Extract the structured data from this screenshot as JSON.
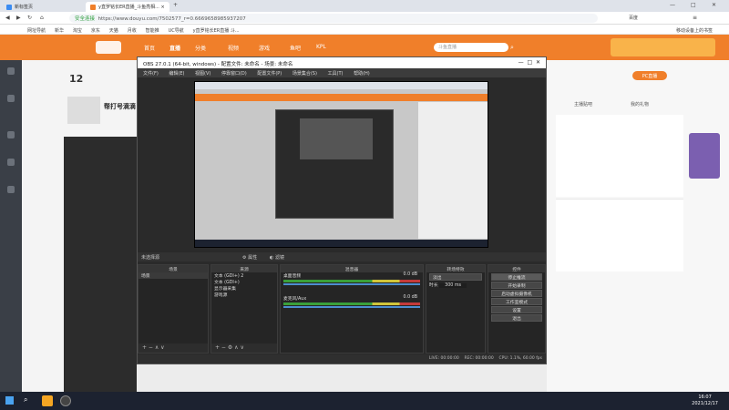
{
  "browser": {
    "tabs": [
      {
        "title": "新标签页"
      },
      {
        "title": "y直罗铭长ER直播_斗鱼亮相..."
      }
    ],
    "url": "https://www.douyu.com/7502577_r=0.6669658985937207",
    "secure_label": "安全连接",
    "search_engine": "百度",
    "bookmarks": [
      "网址导航",
      "新华",
      "淘宝",
      "京东",
      "天猫",
      "月收",
      "智能推",
      "UC导航",
      "y直罗铭长ER直播 斗...",
      "移动设备上的书签"
    ]
  },
  "douyu": {
    "nav": [
      "首页",
      "直播",
      "分类",
      "视频",
      "游戏",
      "鱼吧",
      "KPL"
    ],
    "search_placeholder": "斗鱼直播",
    "left": {
      "count": "12",
      "title": "帮打号滴滴"
    },
    "right": {
      "pcb_btn": "PC直播",
      "follow": "主播贴吧",
      "gift": "我的礼物"
    }
  },
  "obs": {
    "title": "OBS 27.0.1 (64-bit, windows) - 配置文件: 未命名 - 场景: 未命名",
    "menu": [
      "文件(F)",
      "编辑(E)",
      "视图(V)",
      "停靠窗口(D)",
      "配置文件(P)",
      "场景集合(S)",
      "工具(T)",
      "帮助(H)"
    ],
    "no_source": "未选择源",
    "properties": "属性",
    "filters": "滤镜",
    "docks": {
      "scenes": {
        "title": "场景",
        "items": [
          "场景"
        ]
      },
      "sources": {
        "title": "来源",
        "items": [
          "文本 (GDI+) 2",
          "文本 (GDI+)",
          "显示器采集",
          "游戏源"
        ]
      },
      "mixer": {
        "title": "混音器",
        "channels": [
          {
            "name": "桌面音频",
            "db": "0.0 dB"
          },
          {
            "name": "麦克风/Aux",
            "db": "0.0 dB"
          }
        ]
      },
      "transitions": {
        "title": "转场特效",
        "type": "淡出",
        "duration_label": "时长",
        "duration": "300 ms"
      },
      "controls": {
        "title": "控件",
        "buttons": [
          "停止推流",
          "开始录制",
          "启动虚拟摄像机",
          "工作室模式",
          "设置",
          "退出"
        ]
      }
    },
    "status": {
      "live": "LIVE: 00:00:00",
      "rec": "REC: 00:00:00",
      "cpu": "CPU: 1.1%, 60.00 fps"
    }
  },
  "taskbar": {
    "time": "16:07",
    "date": "2021/12/17"
  }
}
